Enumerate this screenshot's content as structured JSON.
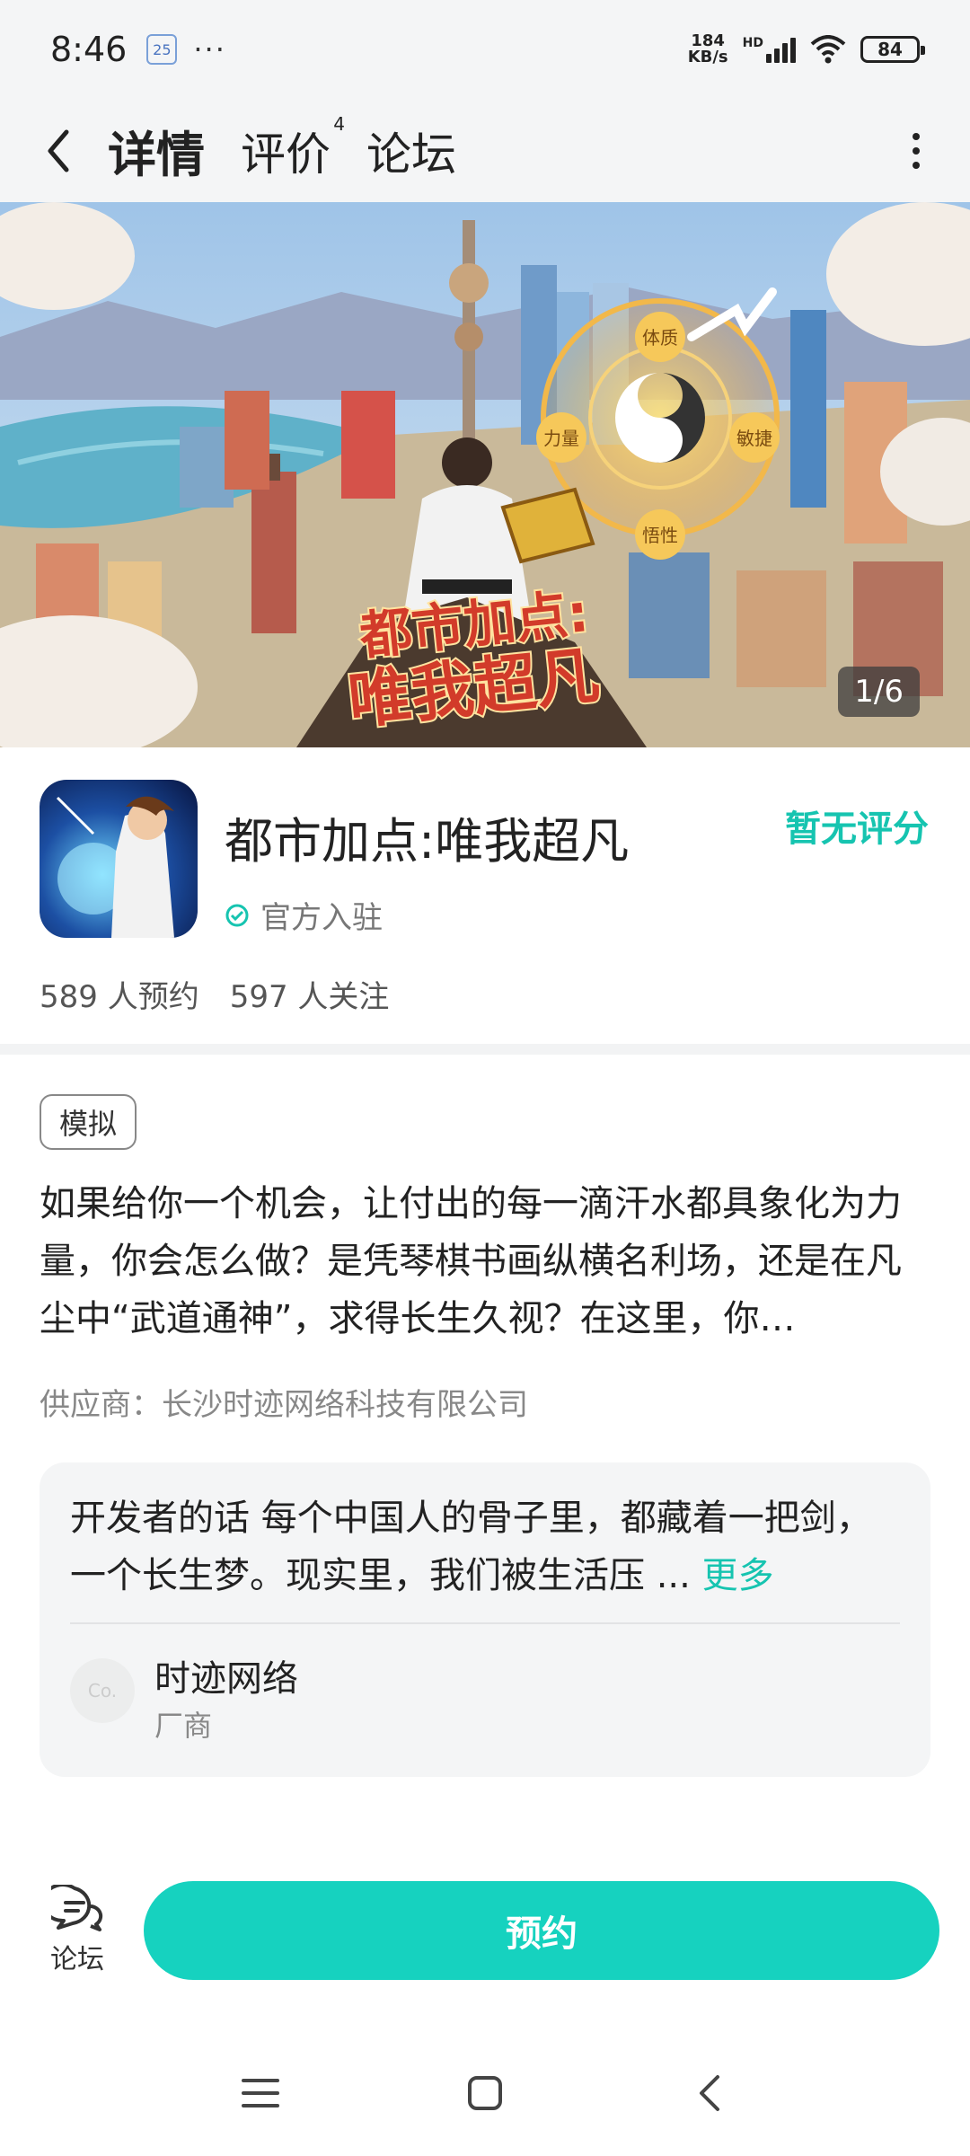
{
  "status_bar": {
    "time": "8:46",
    "notification_badge": "25",
    "more_dots": "···",
    "net_speed_value": "184",
    "net_speed_unit": "KB/s",
    "network_label": "HD",
    "battery": "84"
  },
  "header": {
    "tabs": [
      {
        "label": "详情",
        "active": true
      },
      {
        "label": "评价",
        "count": "4"
      },
      {
        "label": "论坛"
      }
    ]
  },
  "banner": {
    "counter": "1/6",
    "art_title_line1": "都市加点:",
    "art_title_line2": "唯我超凡",
    "seal_labels": [
      "体质",
      "力量",
      "敏捷",
      "悟性"
    ]
  },
  "app": {
    "name": "都市加点:唯我超凡",
    "rating": "暂无评分",
    "official_label": "官方入驻",
    "reservations": "589 人预约",
    "followers": "597 人关注"
  },
  "details": {
    "tag": "模拟",
    "description": "如果给你一个机会，让付出的每一滴汗水都具象化为力量，你会怎么做？是凭琴棋书画纵横名利场，还是在凡尘中“武道通神”，求得长生久视？在这里，你…",
    "supplier": "供应商：长沙时迹网络科技有限公司"
  },
  "developer": {
    "text": "开发者的话  每个中国人的骨子里，都藏着一把剑，一个长生梦。现实里，我们被生活压 ...",
    "more_label": "更多",
    "avatar_text": "Co.",
    "company": "时迹网络",
    "role": "厂商"
  },
  "actions": {
    "forum_label": "论坛",
    "reserve_label": "预约"
  },
  "colors": {
    "accent": "#16d2bf",
    "rating_text": "#16c4b0",
    "header_bg": "#f4f5f6"
  }
}
